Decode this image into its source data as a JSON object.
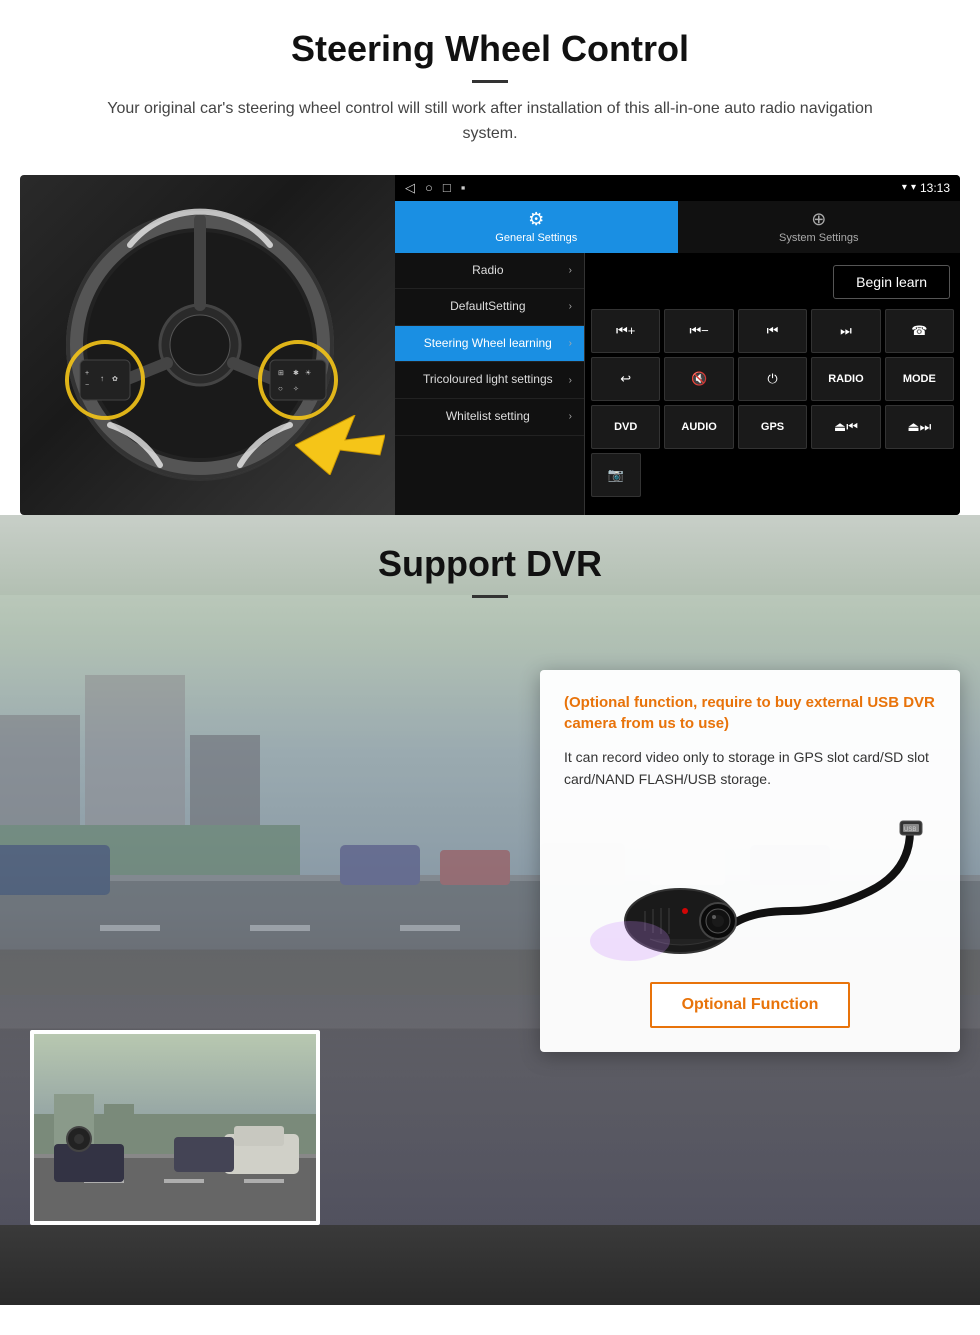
{
  "steering_section": {
    "title": "Steering Wheel Control",
    "description": "Your original car's steering wheel control will still work after installation of this all-in-one auto radio navigation system.",
    "android_ui": {
      "statusbar": {
        "nav_icons": "◁  ○  □  ▪",
        "time": "13:13",
        "signal": "▾"
      },
      "tab_general": {
        "icon": "⚙",
        "label": "General Settings"
      },
      "tab_system": {
        "icon": "⊕",
        "label": "System Settings"
      },
      "menu_items": [
        {
          "label": "Radio",
          "active": false
        },
        {
          "label": "DefaultSetting",
          "active": false
        },
        {
          "label": "Steering Wheel learning",
          "active": true
        },
        {
          "label": "Tricoloured light settings",
          "active": false
        },
        {
          "label": "Whitelist setting",
          "active": false
        }
      ],
      "begin_learn": "Begin learn",
      "control_buttons": {
        "row1": [
          "⏮+",
          "⏮−",
          "⏮⏮",
          "⏭⏭",
          "☎"
        ],
        "row2": [
          "↩",
          "🔇",
          "⏻",
          "RADIO",
          "MODE"
        ],
        "row3": [
          "DVD",
          "AUDIO",
          "GPS",
          "⏏⏮",
          "⏏⏭"
        ],
        "row4": [
          "📷"
        ]
      }
    }
  },
  "dvr_section": {
    "title": "Support DVR",
    "optional_text": "(Optional function, require to buy external USB DVR camera from us to use)",
    "description": "It can record video only to storage in GPS slot card/SD slot card/NAND FLASH/USB storage.",
    "optional_button": "Optional Function"
  }
}
